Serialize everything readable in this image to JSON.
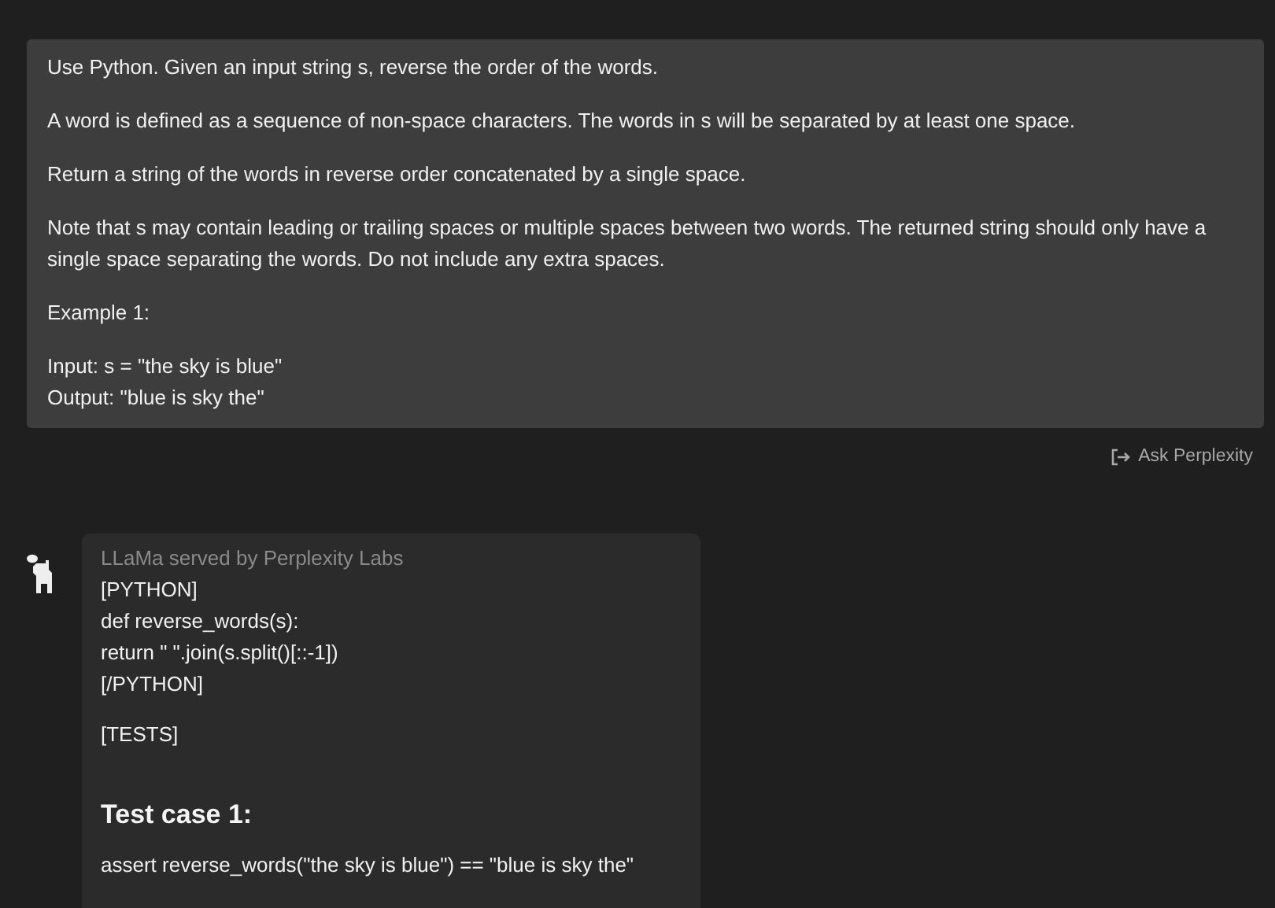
{
  "prompt": {
    "paragraphs": [
      {
        "lines": [
          "Use Python. Given an input string s, reverse the order of the words."
        ]
      },
      {
        "lines": [
          "A word is defined as a sequence of non-space characters. The words in s will be separated by at least one space."
        ]
      },
      {
        "lines": [
          "Return a string of the words in reverse order concatenated by a single space."
        ]
      },
      {
        "lines": [
          "Note that s may contain leading or trailing spaces or multiple spaces between two words. The returned string should only have a single space separating the words. Do not include any extra spaces."
        ]
      },
      {
        "lines": [
          "Example 1:"
        ]
      },
      {
        "lines": [
          "Input: s = \"the sky is blue\"",
          "Output: \"blue is sky the\""
        ]
      }
    ]
  },
  "ask_button": {
    "label": "Ask Perplexity"
  },
  "reply": {
    "model": "LLaMa served by Perplexity Labs",
    "code_lines": [
      "[PYTHON]",
      "def reverse_words(s):",
      "return \" \".join(s.split()[::-1])",
      "[/PYTHON]"
    ],
    "tests_label": "[TESTS]",
    "heading": "Test case 1:",
    "assert_line": "assert reverse_words(\"the sky is blue\") == \"blue is sky the\""
  }
}
